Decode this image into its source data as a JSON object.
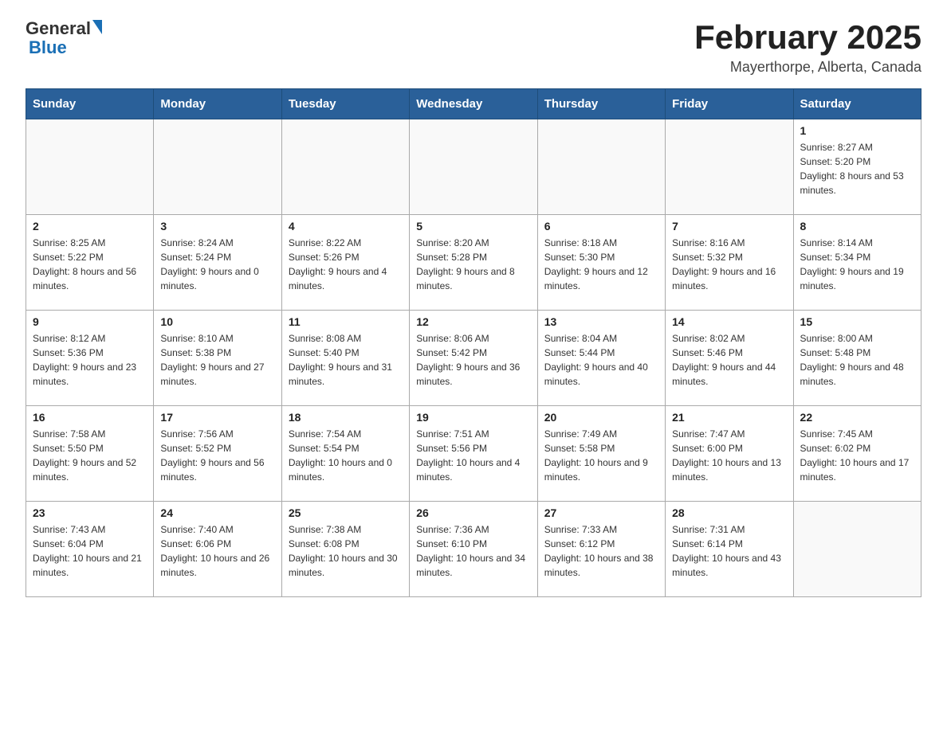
{
  "header": {
    "logo_text_general": "General",
    "logo_text_blue": "Blue",
    "title": "February 2025",
    "subtitle": "Mayerthorpe, Alberta, Canada"
  },
  "calendar": {
    "days_of_week": [
      "Sunday",
      "Monday",
      "Tuesday",
      "Wednesday",
      "Thursday",
      "Friday",
      "Saturday"
    ],
    "weeks": [
      [
        {
          "day": "",
          "info": ""
        },
        {
          "day": "",
          "info": ""
        },
        {
          "day": "",
          "info": ""
        },
        {
          "day": "",
          "info": ""
        },
        {
          "day": "",
          "info": ""
        },
        {
          "day": "",
          "info": ""
        },
        {
          "day": "1",
          "info": "Sunrise: 8:27 AM\nSunset: 5:20 PM\nDaylight: 8 hours and 53 minutes."
        }
      ],
      [
        {
          "day": "2",
          "info": "Sunrise: 8:25 AM\nSunset: 5:22 PM\nDaylight: 8 hours and 56 minutes."
        },
        {
          "day": "3",
          "info": "Sunrise: 8:24 AM\nSunset: 5:24 PM\nDaylight: 9 hours and 0 minutes."
        },
        {
          "day": "4",
          "info": "Sunrise: 8:22 AM\nSunset: 5:26 PM\nDaylight: 9 hours and 4 minutes."
        },
        {
          "day": "5",
          "info": "Sunrise: 8:20 AM\nSunset: 5:28 PM\nDaylight: 9 hours and 8 minutes."
        },
        {
          "day": "6",
          "info": "Sunrise: 8:18 AM\nSunset: 5:30 PM\nDaylight: 9 hours and 12 minutes."
        },
        {
          "day": "7",
          "info": "Sunrise: 8:16 AM\nSunset: 5:32 PM\nDaylight: 9 hours and 16 minutes."
        },
        {
          "day": "8",
          "info": "Sunrise: 8:14 AM\nSunset: 5:34 PM\nDaylight: 9 hours and 19 minutes."
        }
      ],
      [
        {
          "day": "9",
          "info": "Sunrise: 8:12 AM\nSunset: 5:36 PM\nDaylight: 9 hours and 23 minutes."
        },
        {
          "day": "10",
          "info": "Sunrise: 8:10 AM\nSunset: 5:38 PM\nDaylight: 9 hours and 27 minutes."
        },
        {
          "day": "11",
          "info": "Sunrise: 8:08 AM\nSunset: 5:40 PM\nDaylight: 9 hours and 31 minutes."
        },
        {
          "day": "12",
          "info": "Sunrise: 8:06 AM\nSunset: 5:42 PM\nDaylight: 9 hours and 36 minutes."
        },
        {
          "day": "13",
          "info": "Sunrise: 8:04 AM\nSunset: 5:44 PM\nDaylight: 9 hours and 40 minutes."
        },
        {
          "day": "14",
          "info": "Sunrise: 8:02 AM\nSunset: 5:46 PM\nDaylight: 9 hours and 44 minutes."
        },
        {
          "day": "15",
          "info": "Sunrise: 8:00 AM\nSunset: 5:48 PM\nDaylight: 9 hours and 48 minutes."
        }
      ],
      [
        {
          "day": "16",
          "info": "Sunrise: 7:58 AM\nSunset: 5:50 PM\nDaylight: 9 hours and 52 minutes."
        },
        {
          "day": "17",
          "info": "Sunrise: 7:56 AM\nSunset: 5:52 PM\nDaylight: 9 hours and 56 minutes."
        },
        {
          "day": "18",
          "info": "Sunrise: 7:54 AM\nSunset: 5:54 PM\nDaylight: 10 hours and 0 minutes."
        },
        {
          "day": "19",
          "info": "Sunrise: 7:51 AM\nSunset: 5:56 PM\nDaylight: 10 hours and 4 minutes."
        },
        {
          "day": "20",
          "info": "Sunrise: 7:49 AM\nSunset: 5:58 PM\nDaylight: 10 hours and 9 minutes."
        },
        {
          "day": "21",
          "info": "Sunrise: 7:47 AM\nSunset: 6:00 PM\nDaylight: 10 hours and 13 minutes."
        },
        {
          "day": "22",
          "info": "Sunrise: 7:45 AM\nSunset: 6:02 PM\nDaylight: 10 hours and 17 minutes."
        }
      ],
      [
        {
          "day": "23",
          "info": "Sunrise: 7:43 AM\nSunset: 6:04 PM\nDaylight: 10 hours and 21 minutes."
        },
        {
          "day": "24",
          "info": "Sunrise: 7:40 AM\nSunset: 6:06 PM\nDaylight: 10 hours and 26 minutes."
        },
        {
          "day": "25",
          "info": "Sunrise: 7:38 AM\nSunset: 6:08 PM\nDaylight: 10 hours and 30 minutes."
        },
        {
          "day": "26",
          "info": "Sunrise: 7:36 AM\nSunset: 6:10 PM\nDaylight: 10 hours and 34 minutes."
        },
        {
          "day": "27",
          "info": "Sunrise: 7:33 AM\nSunset: 6:12 PM\nDaylight: 10 hours and 38 minutes."
        },
        {
          "day": "28",
          "info": "Sunrise: 7:31 AM\nSunset: 6:14 PM\nDaylight: 10 hours and 43 minutes."
        },
        {
          "day": "",
          "info": ""
        }
      ]
    ]
  }
}
